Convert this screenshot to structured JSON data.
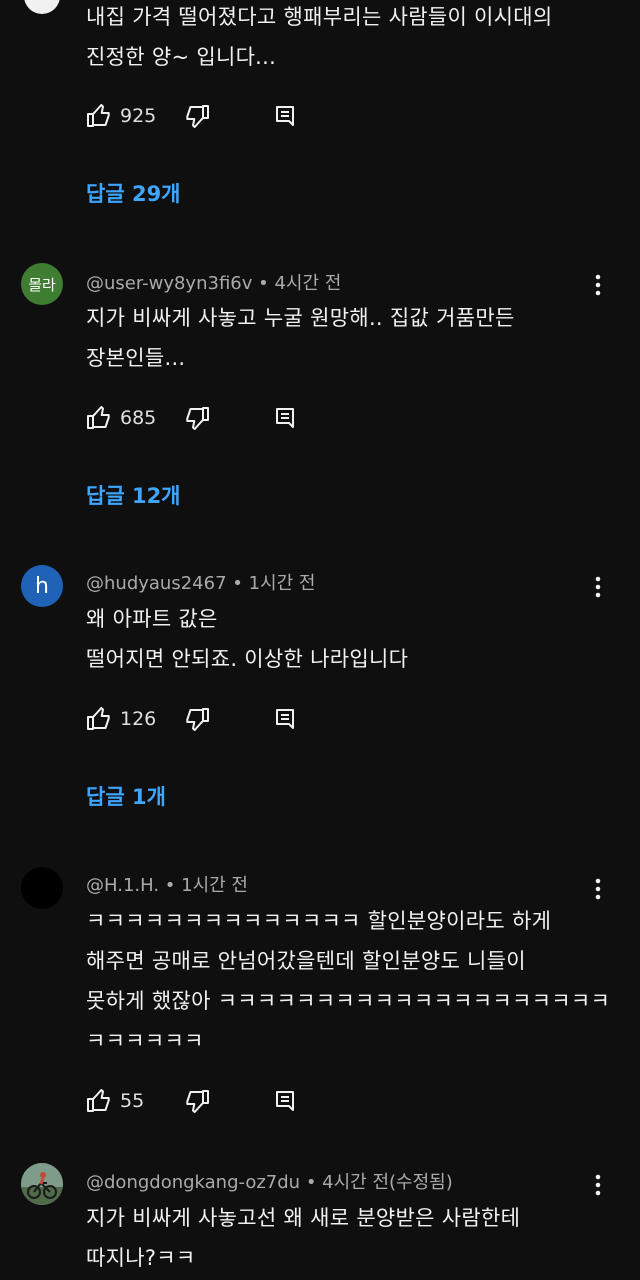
{
  "comments": [
    {
      "author": "",
      "time": "",
      "text_lines": [
        "내집 가격 떨어졌다고 행패부리는 사람들이 이시대의",
        "진정한 양~ 입니다..."
      ],
      "likes": "925",
      "replies": "답글 29개"
    },
    {
      "avatar_text": "몰라",
      "author": "@user-wy8yn3fi6v",
      "time": "4시간 전",
      "text_lines": [
        "지가 비싸게 사놓고 누굴 원망해.. 집값 거품만든",
        "장본인들..."
      ],
      "likes": "685",
      "replies": "답글 12개"
    },
    {
      "avatar_text": "h",
      "author": "@hudyaus2467",
      "time": "1시간 전",
      "text_lines": [
        "왜 아파트 값은",
        "떨어지면 안되죠.  이상한 나라입니다"
      ],
      "likes": "126",
      "replies": "답글 1개"
    },
    {
      "author": "@H.1.H.",
      "time": "1시간 전",
      "text_lines": [
        "ㅋㅋㅋㅋㅋㅋㅋㅋㅋㅋㅋㅋㅋㅋ 할인분양이라도 하게",
        "해주면 공매로 안넘어갔을텐데 할인분양도 니들이",
        "못하게 했잖아 ㅋㅋㅋㅋㅋㅋㅋㅋㅋㅋㅋㅋㅋㅋㅋㅋㅋㅋㅋㅋ",
        "ㅋㅋㅋㅋㅋㅋ"
      ],
      "likes": "55"
    },
    {
      "author": "@dongdongkang-oz7du",
      "time": "4시간 전(수정됨)",
      "text_lines": [
        "지가 비싸게 사놓고선 왜 새로 분양받은 사람한테",
        "따지나?ㅋㅋ"
      ]
    }
  ],
  "colors": {
    "background": "#0f0f0f",
    "text": "#f1f1f1",
    "meta": "#aaaaaa",
    "reply_link": "#3ea6ff"
  },
  "icons": {
    "like": "thumbs-up-icon",
    "dislike": "thumbs-down-icon",
    "reply": "comment-reply-icon",
    "more": "kebab-menu-icon"
  }
}
